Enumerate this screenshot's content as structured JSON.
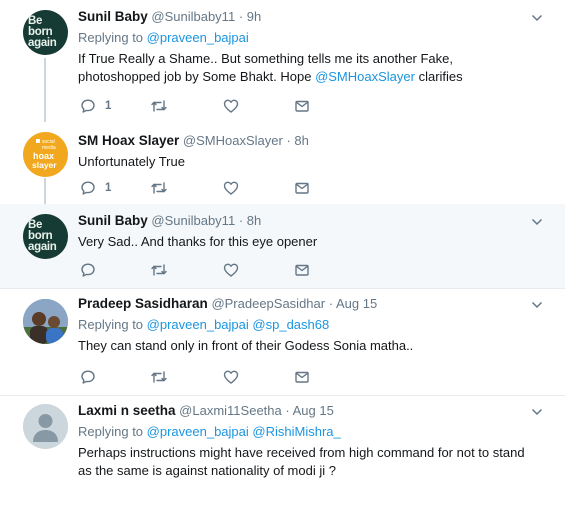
{
  "tweets": [
    {
      "name": "Sunil Baby",
      "handle": "@Sunilbaby11",
      "dot": "·",
      "time": "9h",
      "avatar_lines": [
        "Be",
        "born",
        "again"
      ],
      "replying_prefix": "Replying to",
      "replying_to": [
        "@praveen_bajpai"
      ],
      "text_parts": [
        "If True Really a Shame.. But something tells me its another Fake, photoshopped job by Some Bhakt. Hope ",
        "@SMHoaxSlayer",
        " clarifies"
      ],
      "reply_count": "1"
    },
    {
      "name": "SM Hoax Slayer",
      "handle": "@SMHoaxSlayer",
      "dot": "·",
      "time": "8h",
      "avatar_lines": [
        "social",
        "media",
        "hoax",
        "slayer"
      ],
      "text": "Unfortunately True",
      "reply_count": "1"
    },
    {
      "name": "Sunil Baby",
      "handle": "@Sunilbaby11",
      "dot": "·",
      "time": "8h",
      "avatar_lines": [
        "Be",
        "born",
        "again"
      ],
      "text": "Very Sad.. And thanks for this eye opener"
    },
    {
      "name": "Pradeep Sasidharan",
      "handle": "@PradeepSasidhar",
      "dot": "·",
      "time": "Aug 15",
      "replying_prefix": "Replying to",
      "replying_to": [
        "@praveen_bajpai",
        "@sp_dash68"
      ],
      "text": "They can stand only in front of their Godess Sonia matha.."
    },
    {
      "name": "Laxmi n seetha",
      "handle": "@Laxmi11Seetha",
      "dot": "·",
      "time": "Aug 15",
      "replying_prefix": "Replying to",
      "replying_to": [
        "@praveen_bajpai",
        "@RishiMishra_"
      ],
      "text": "Perhaps instructions might have received from high command for not to stand as the same is against nationality of modi ji ?"
    }
  ],
  "colors": {
    "link": "#1b95e0",
    "secondary": "#657786",
    "highlight_bg": "#f5f8fa",
    "divider": "#e6ecf0"
  },
  "icons": [
    "reply-icon",
    "retweet-icon",
    "like-icon",
    "dm-icon",
    "chevron-down-icon"
  ]
}
